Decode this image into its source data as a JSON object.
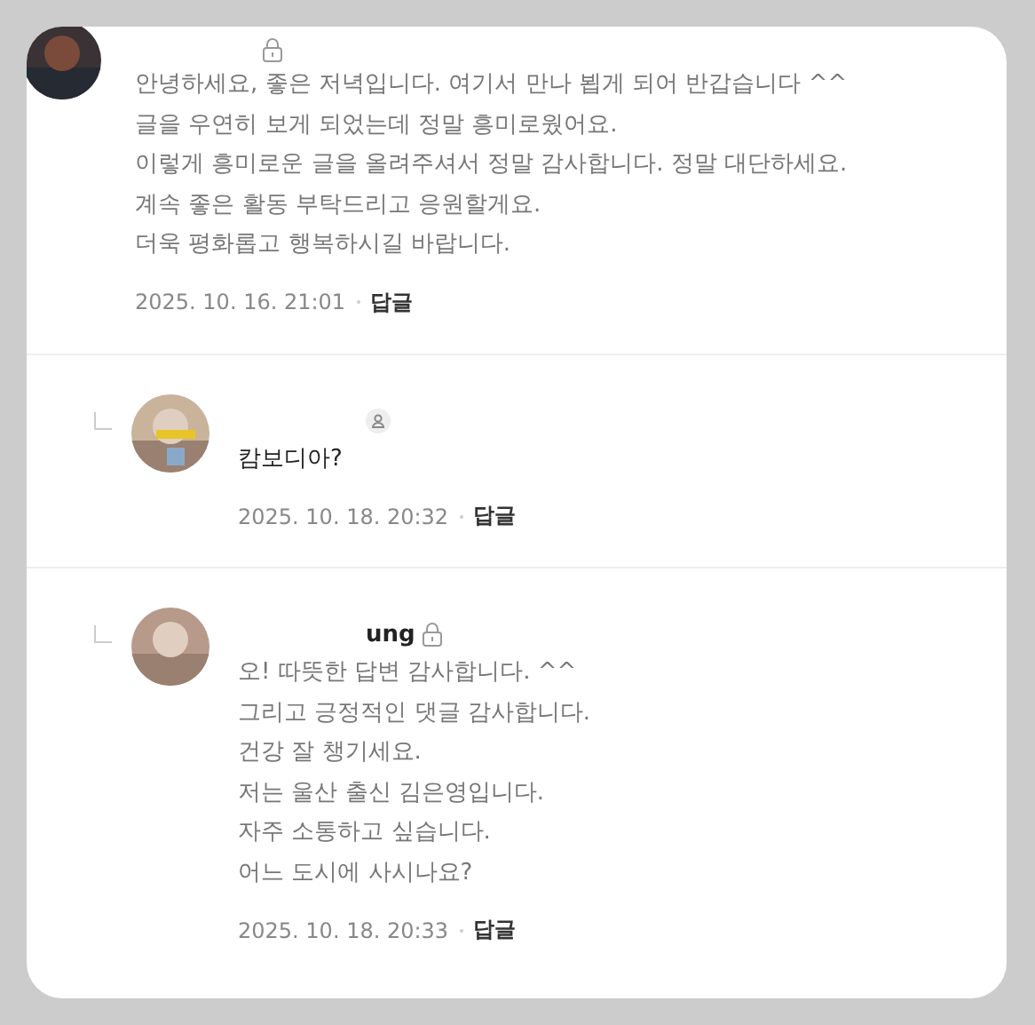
{
  "comments": [
    {
      "is_reply": false,
      "secret": true,
      "lines": [
        "안녕하세요, 좋은 저녁입니다. 여기서 만나 뵙게 되어 반갑습니다 ^^",
        "글을 우연히 보게 되었는데 정말 흥미로웠어요.",
        "이렇게 흥미로운 글을 올려주셔서 정말 감사합니다. 정말 대단하세요.",
        "계속 좋은 활동 부탁드리고 응원할게요.",
        "더욱 평화롭고 행복하시길 바랍니다."
      ],
      "date": "2025. 10. 16. 21:01",
      "reply_label": "답글"
    },
    {
      "is_reply": true,
      "secret": false,
      "lines": [
        "캄보디아?"
      ],
      "date": "2025. 10. 18. 20:32",
      "reply_label": "답글"
    },
    {
      "is_reply": true,
      "author": "ung",
      "secret": true,
      "lines": [
        "오! 따뜻한 답변 감사합니다. ^^",
        "그리고 긍정적인 댓글 감사합니다.",
        "건강 잘 챙기세요.",
        "저는 울산 출신 김은영입니다.",
        "자주 소통하고 싶습니다.",
        "어느 도시에 사시나요?"
      ],
      "date": "2025. 10. 18. 20:33",
      "reply_label": "답글"
    }
  ]
}
